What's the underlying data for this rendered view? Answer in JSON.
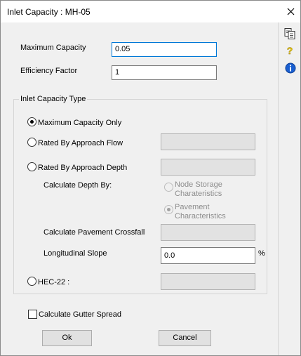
{
  "window": {
    "title": "Inlet Capacity : MH-05"
  },
  "fields": {
    "max_capacity": {
      "label": "Maximum Capacity",
      "value": "0.05"
    },
    "efficiency": {
      "label": "Efficiency Factor",
      "value": "1"
    }
  },
  "inlet_type": {
    "legend": "Inlet Capacity Type",
    "options": {
      "max_only": "Maximum Capacity Only",
      "approach_flow": "Rated By Approach Flow",
      "approach_depth": "Rated By Approach Depth",
      "hec22": "HEC-22 :"
    },
    "selected": "max_only",
    "calc_depth_label": "Calculate Depth By:",
    "depth_options": {
      "node_storage_line1": "Node Storage",
      "node_storage_line2": "Charateristics",
      "pavement_line1": "Pavement",
      "pavement_line2": "Characteristics"
    },
    "crossfall_label": "Calculate Pavement Crossfall",
    "long_slope_label": "Longitudinal Slope",
    "long_slope_value": "0.0",
    "long_slope_unit": "%"
  },
  "gutter": {
    "label": "Calculate Gutter Spread",
    "checked": false
  },
  "buttons": {
    "ok": "Ok",
    "cancel": "Cancel"
  },
  "side_icons": [
    "copy-icon",
    "help-icon",
    "info-icon"
  ],
  "colors": {
    "focus_border": "#0078d7",
    "info_blue": "#1a5fd0",
    "help_yellow": "#e6c600"
  }
}
